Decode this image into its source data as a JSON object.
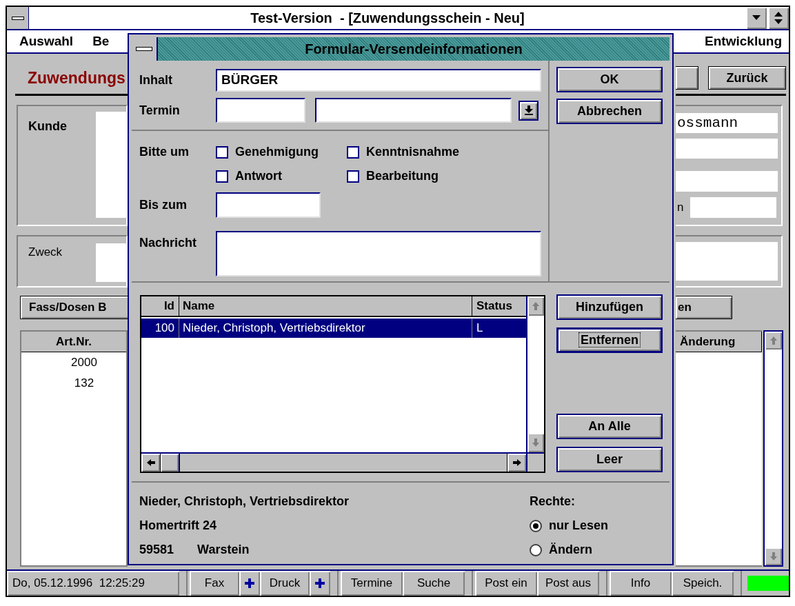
{
  "window": {
    "title": "Test-Version  - [Zuwendungsschein - Neu]",
    "menu": [
      {
        "label": "Auswahl"
      },
      {
        "label": "Be"
      },
      {
        "label": "Entwicklung"
      }
    ]
  },
  "main": {
    "heading": "Zuwendungs",
    "back_button": "Zurück",
    "customer": {
      "label": "Kunde",
      "name_value": "ossmann",
      "field_label": "n"
    },
    "purpose": {
      "label": "Zweck"
    },
    "left_button": "Fass/Dosen B",
    "right_button": "en",
    "articles": {
      "column": "Art.Nr.",
      "rows": [
        "2000",
        "132"
      ]
    },
    "changes": {
      "column": "Änderung"
    }
  },
  "dialog": {
    "title": "Formular-Versendeinformationen",
    "content": {
      "label": "Inhalt",
      "value": "BÜRGER"
    },
    "date": {
      "label": "Termin"
    },
    "request": {
      "label": "Bitte um",
      "options": [
        {
          "label": "Genehmigung",
          "checked": false
        },
        {
          "label": "Kenntnisnahme",
          "checked": false
        },
        {
          "label": "Antwort",
          "checked": false
        },
        {
          "label": "Bearbeitung",
          "checked": false
        }
      ]
    },
    "until": {
      "label": "Bis zum"
    },
    "message": {
      "label": "Nachricht"
    },
    "top_buttons": [
      {
        "label": "OK",
        "focused": false
      },
      {
        "label": "Abbrechen",
        "focused": false
      }
    ],
    "recipients": {
      "columns": [
        "Id",
        "Name",
        "Status"
      ],
      "rows": [
        {
          "id": "100",
          "name": "Nieder, Christoph, Vertriebsdirektor",
          "status": "L",
          "selected": true
        }
      ]
    },
    "list_buttons": [
      {
        "label": "Hinzufügen",
        "focused": false
      },
      {
        "label": "Entfernen",
        "focused": true
      }
    ],
    "bottom_buttons": [
      {
        "label": "An Alle",
        "focused": false
      },
      {
        "label": "Leer",
        "focused": false
      }
    ],
    "address": {
      "lines": [
        "Nieder, Christoph, Vertriebsdirektor",
        "Homertrift 24"
      ],
      "postcode": "59581",
      "city": "Warstein"
    },
    "rights": {
      "label": "Rechte:",
      "options": [
        {
          "label": "nur Lesen",
          "selected": true
        },
        {
          "label": "Ändern",
          "selected": false
        }
      ]
    }
  },
  "status_bar": {
    "datetime": "Do, 05.12.1996  12:25:29",
    "groups": [
      [
        {
          "label": "Fax",
          "has_plus": true
        },
        {
          "label": "Druck",
          "has_plus": true
        }
      ],
      [
        {
          "label": "Termine",
          "has_plus": false
        },
        {
          "label": "Suche",
          "has_plus": false
        }
      ],
      [
        {
          "label": "Post ein",
          "has_plus": false
        },
        {
          "label": "Post aus",
          "has_plus": false
        }
      ],
      [
        {
          "label": "Info",
          "has_plus": false
        },
        {
          "label": "Speich.",
          "has_plus": false
        }
      ]
    ]
  }
}
